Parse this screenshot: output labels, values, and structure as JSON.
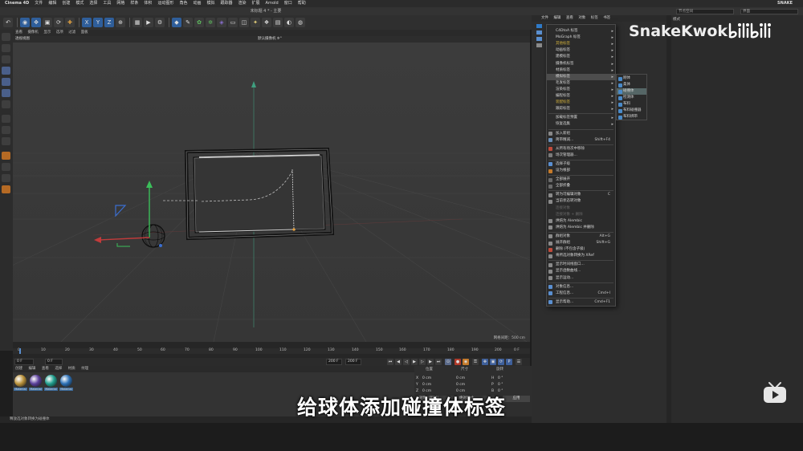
{
  "mac_menubar": {
    "app_name": "Cinema 4D",
    "items": [
      "文件",
      "编辑",
      "创建",
      "模式",
      "选择",
      "工具",
      "网格",
      "样条",
      "体积",
      "运动图形",
      "角色",
      "动画",
      "模拟",
      "跟踪器",
      "渲染",
      "扩展",
      "Arnold",
      "窗口",
      "帮助"
    ],
    "right_label": "SNAKE"
  },
  "window": {
    "title": "未标题 4 * - 主要",
    "node_space_label": "节点空间",
    "layout_label": "界面"
  },
  "toolbar": {
    "axis_labels": [
      "X",
      "Y",
      "Z"
    ]
  },
  "viewport": {
    "menu": [
      "查看",
      "摄像机",
      "显示",
      "选项",
      "过滤",
      "面板"
    ],
    "left_label": "透视视图",
    "camera_label": "默认摄像机 ✲°",
    "grid_readout": "网格间距：500 cm"
  },
  "timeline": {
    "ticks": [
      "0",
      "10",
      "20",
      "30",
      "40",
      "50",
      "60",
      "70",
      "80",
      "90",
      "100",
      "110",
      "120",
      "130",
      "140",
      "150",
      "160",
      "170",
      "180",
      "190",
      "200"
    ],
    "end_frame_label": "0 F",
    "current_frame": "0 F",
    "start_frame": "0 F",
    "end_frame": "200 F",
    "end_frame2": "200 F"
  },
  "materials": {
    "menu": [
      "创建",
      "编辑",
      "查看",
      "选择",
      "材质",
      "纹理"
    ],
    "items": [
      {
        "label": "Material",
        "color": "#b9913a"
      },
      {
        "label": "Material",
        "color": "#5a3f9a"
      },
      {
        "label": "Material",
        "color": "#1f9d8c"
      },
      {
        "label": "Material",
        "color": "#2b6fb5"
      }
    ]
  },
  "coords": {
    "headers": [
      "位置",
      "尺寸",
      "旋转"
    ],
    "rows": [
      {
        "axis": "X",
        "pos": "0 cm",
        "size": "0 cm",
        "rot_axis": "H",
        "rot": "0 °"
      },
      {
        "axis": "Y",
        "pos": "0 cm",
        "size": "0 cm",
        "rot_axis": "P",
        "rot": "0 °"
      },
      {
        "axis": "Z",
        "pos": "0 cm",
        "size": "0 cm",
        "rot_axis": "B",
        "rot": "0 °"
      }
    ],
    "mode_left": "对象（相对）",
    "mode_right": "绝对尺寸",
    "apply_label": "应用"
  },
  "status_text": "释放选对象转换为碰撞体",
  "object_manager": {
    "menu": [
      "文件",
      "编辑",
      "查看",
      "对象",
      "标签",
      "书签"
    ]
  },
  "attributes": {
    "mode_label": "模式"
  },
  "context_menu": {
    "items": [
      {
        "label": "C4DtoA 标签",
        "arrow": true
      },
      {
        "label": "MoGraph 标签",
        "arrow": true
      },
      {
        "label": "其他标签",
        "arrow": true,
        "hot": true
      },
      {
        "label": "动画标签",
        "arrow": true
      },
      {
        "label": "建模标签",
        "arrow": true
      },
      {
        "label": "摄像机标签",
        "arrow": true
      },
      {
        "label": "材质标签",
        "arrow": true
      },
      {
        "label": "模拟标签",
        "arrow": true,
        "highlight": true
      },
      {
        "label": "毛发标签",
        "arrow": true
      },
      {
        "label": "渲染标签",
        "arrow": true
      },
      {
        "label": "编程标签",
        "arrow": true
      },
      {
        "label": "装配标签",
        "arrow": true,
        "hot": true
      },
      {
        "label": "跟踪标签",
        "arrow": true
      },
      {
        "separator": true
      },
      {
        "label": "加载标签预置",
        "arrow": true
      },
      {
        "label": "恢复选集",
        "arrow": true
      },
      {
        "separator": true
      },
      {
        "label": "加入新组",
        "icon": "#888"
      },
      {
        "label": "简带精减...",
        "shortcut": "Shift+F4",
        "icon": "#6a8fb8"
      },
      {
        "separator": true
      },
      {
        "label": "从所有场次中移除",
        "icon": "#c04a3a"
      },
      {
        "label": "场次管理器...",
        "icon": "#7a7a7a"
      },
      {
        "separator": true
      },
      {
        "label": "选择子级",
        "icon": "#5a8fd0"
      },
      {
        "label": "设为根部",
        "icon": "#c57a2a"
      },
      {
        "separator": true
      },
      {
        "label": "全部展开",
        "icon": "#6a6a6a"
      },
      {
        "label": "全部折叠",
        "icon": "#6a6a6a"
      },
      {
        "separator": true
      },
      {
        "label": "转为可编辑对象",
        "shortcut": "C",
        "icon": "#8a8a8a"
      },
      {
        "label": "当前状态转对象",
        "icon": "#8a8a8a"
      },
      {
        "label": "连接对象",
        "dim": true
      },
      {
        "label": "连接对象 + 删除",
        "dim": true
      },
      {
        "label": "烘焙为 Alembic",
        "icon": "#8a8a8a"
      },
      {
        "label": "烘焙为 Alembic 并删除",
        "icon": "#8a8a8a"
      },
      {
        "separator": true
      },
      {
        "label": "群组对象",
        "shortcut": "Alt+G",
        "icon": "#8a8a8a"
      },
      {
        "label": "展开群组",
        "shortcut": "Shift+G",
        "icon": "#8a8a8a"
      },
      {
        "label": "删除 (不包含子级)",
        "icon": "#c04a3a"
      },
      {
        "label": "将所选对象转换为 XRef",
        "icon": "#8a8a8a"
      },
      {
        "separator": true
      },
      {
        "label": "显示时间线窗口...",
        "icon": "#8a8a8a"
      },
      {
        "label": "显示函数曲线...",
        "icon": "#8a8a8a"
      },
      {
        "label": "显示运动...",
        "icon": "#8a8a8a"
      },
      {
        "separator": true
      },
      {
        "label": "对象信息...",
        "icon": "#5a8fd0"
      },
      {
        "label": "工程信息...",
        "shortcut": "Cmd+I",
        "icon": "#5a8fd0"
      },
      {
        "separator": true
      },
      {
        "label": "显示帮助...",
        "shortcut": "Cmd+F1",
        "icon": "#5a8fd0"
      }
    ]
  },
  "submenu": {
    "items": [
      {
        "label": "刚体",
        "icon": "#4a8ac8"
      },
      {
        "label": "柔体",
        "icon": "#4a8ac8"
      },
      {
        "label": "碰撞体",
        "icon": "#4a8ac8",
        "highlight": true
      },
      {
        "label": "检测体",
        "icon": "#4a8ac8"
      },
      {
        "label": "布料",
        "icon": "#4a8ac8"
      },
      {
        "label": "布料碰撞器",
        "icon": "#4a8ac8"
      },
      {
        "label": "布料绑带",
        "icon": "#4a8ac8"
      }
    ]
  },
  "overlay": {
    "subtitle": "给球体添加碰撞体标签",
    "watermark": "SnakeKwok",
    "logo_text": "bilibili"
  }
}
